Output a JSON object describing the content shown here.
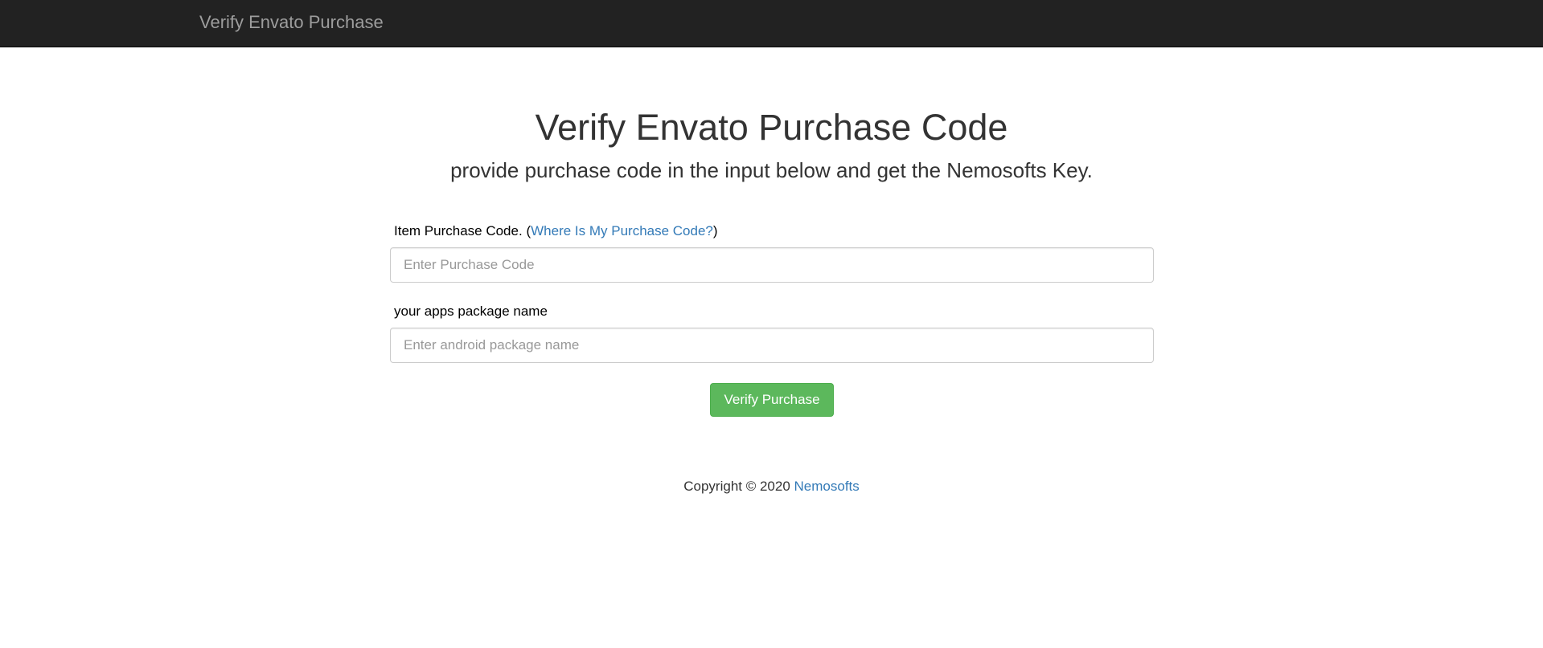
{
  "navbar": {
    "brand": "Verify Envato Purchase"
  },
  "header": {
    "title": "Verify Envato Purchase Code",
    "subtitle": "provide purchase code in the input below and get the Nemosofts Key."
  },
  "form": {
    "purchase_code": {
      "label": "Item Purchase Code.",
      "paren_open": "(",
      "help_link": "Where Is My Purchase Code?",
      "paren_close": ")",
      "value": "",
      "placeholder": "Enter Purchase Code"
    },
    "package_name": {
      "label": "your apps package name",
      "value": "",
      "placeholder": "Enter android package name"
    },
    "submit_label": "Verify Purchase"
  },
  "footer": {
    "copyright": "Copyright © 2020",
    "company": "Nemosofts"
  },
  "colors": {
    "navbar_bg": "#222222",
    "brand_text": "#9d9d9d",
    "link": "#337ab7",
    "button_bg": "#5cb85c",
    "text": "#333333"
  }
}
